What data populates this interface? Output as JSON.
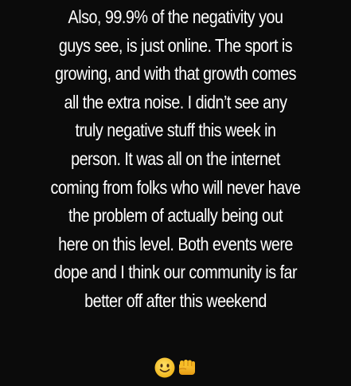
{
  "story": {
    "caption_lines": [
      "Also, 99.9% of the negativity you",
      "guys see, is just online. The sport is",
      "growing, and with that growth comes",
      "all the extra noise. I didn’t see any",
      "truly negative stuff this week in",
      "person. It was all on the internet",
      "coming from folks who will never have",
      "the problem of actually being out",
      "here on this level. Both events were",
      "dope and I think our community is far",
      "better off after this weekend"
    ],
    "emojis": [
      {
        "name": "slightly-smiling-face-icon"
      },
      {
        "name": "oncoming-fist-icon"
      }
    ]
  },
  "colors": {
    "background": "#0b0b0b",
    "text": "#ffffff",
    "emoji_yellow": "#f7c21e",
    "emoji_orange": "#e8a017"
  }
}
